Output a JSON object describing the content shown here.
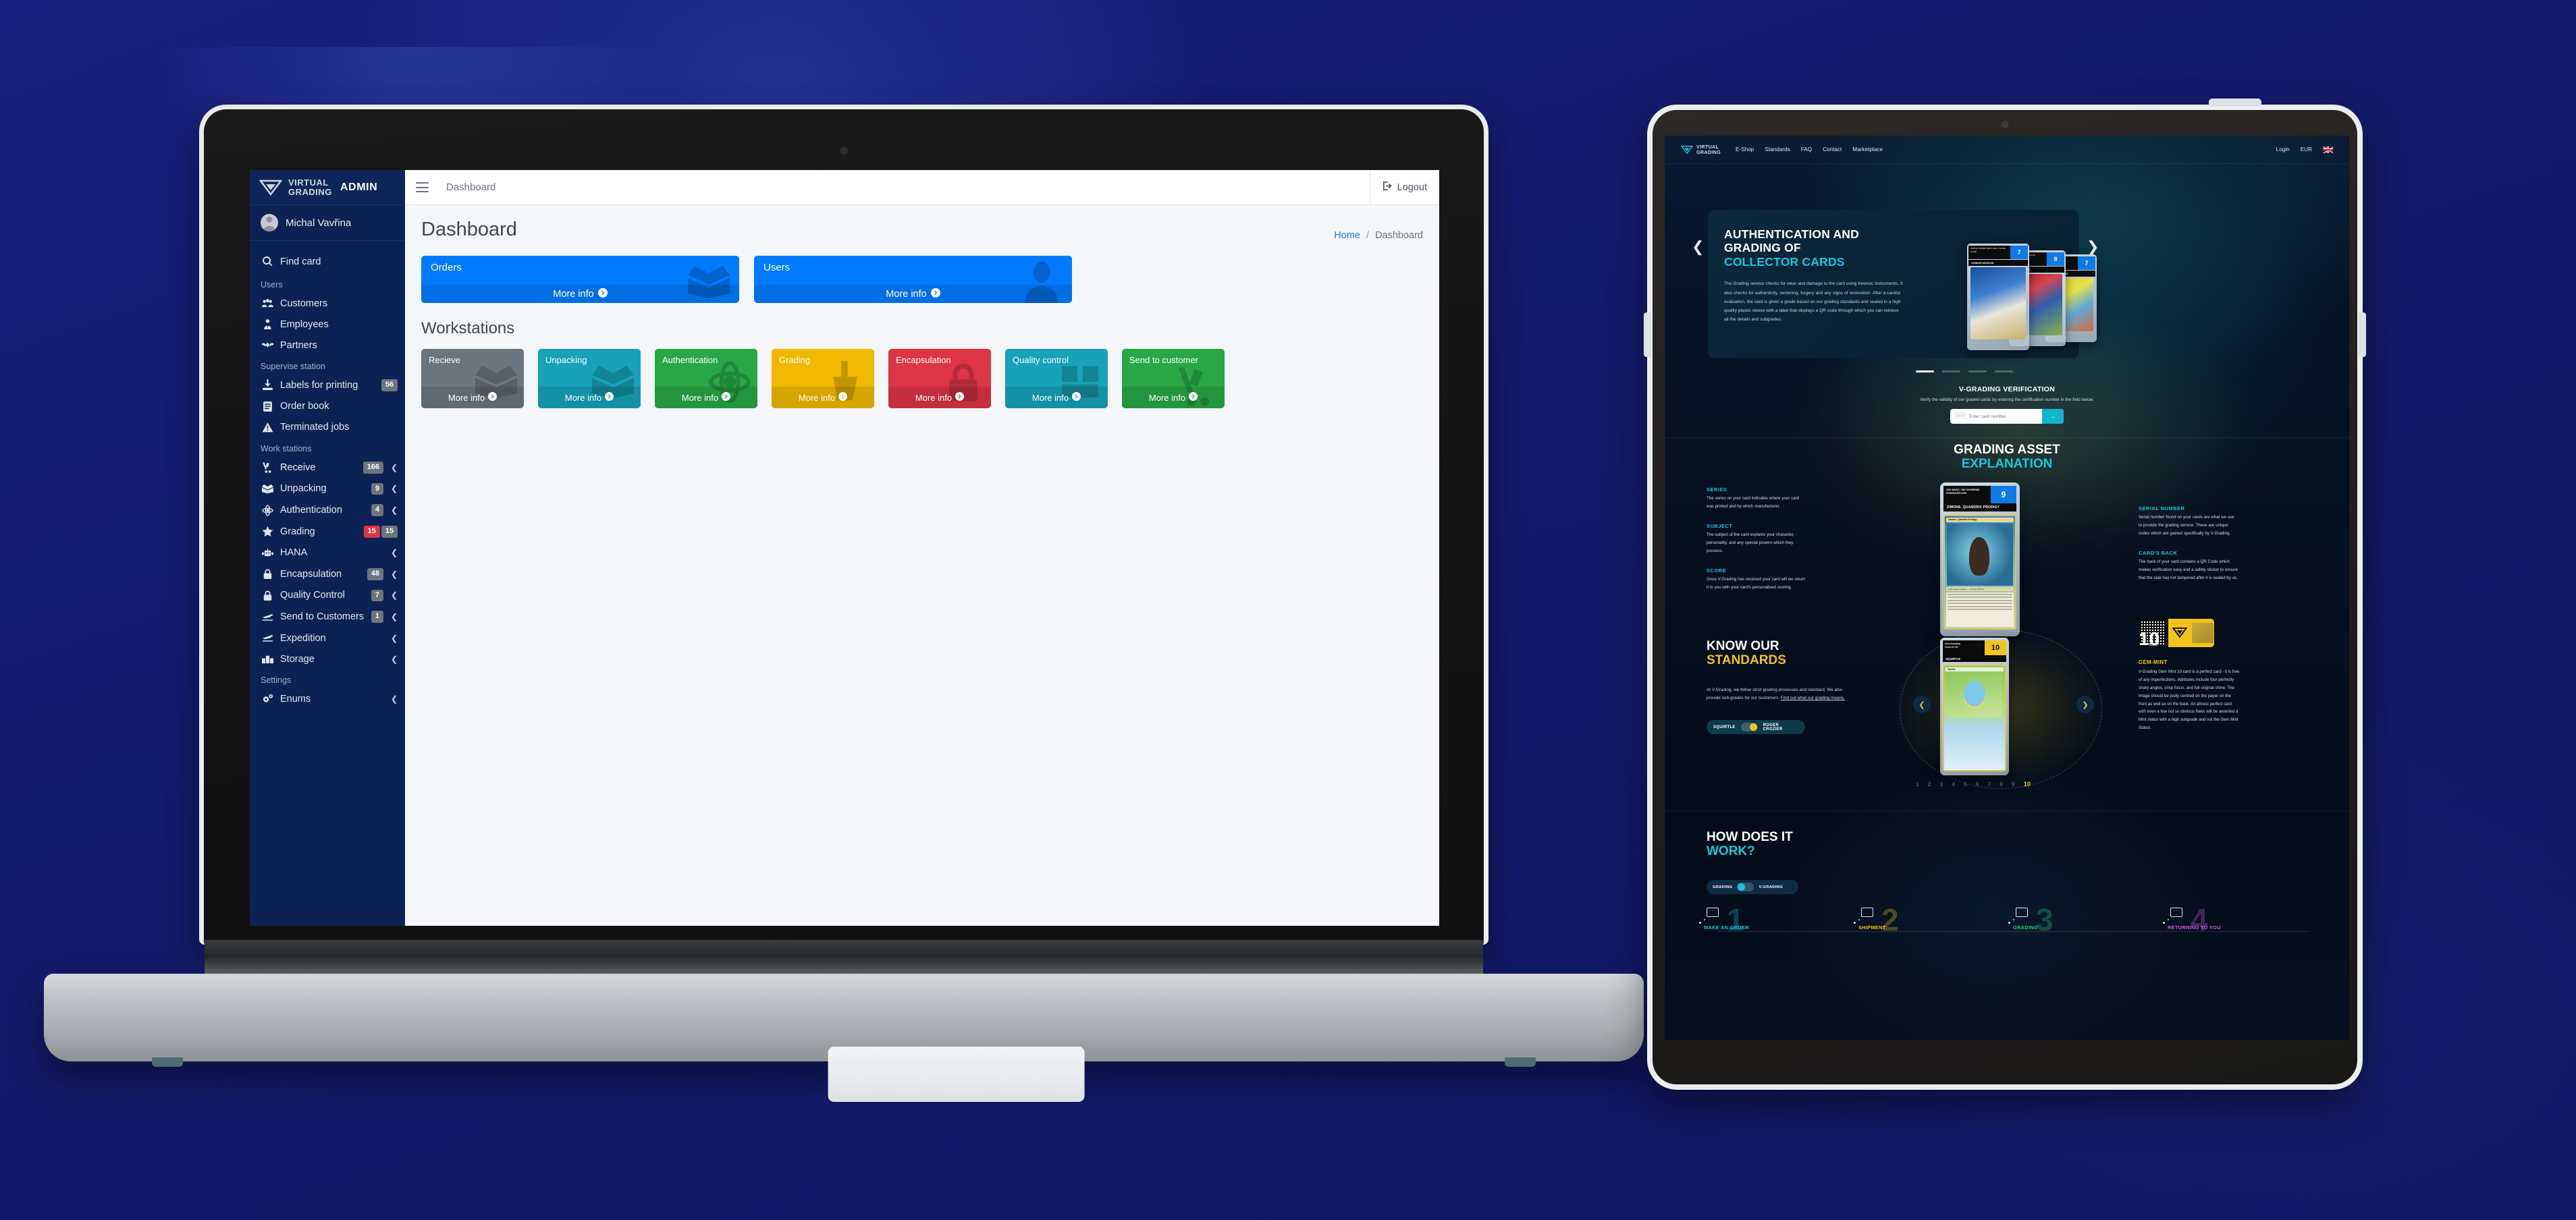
{
  "background": {
    "color": "#151c6e"
  },
  "laptop": {
    "admin_app": {
      "sidebar": {
        "brand": {
          "logo_line1": "VIRTUAL",
          "logo_line2": "GRADING",
          "suffix": "ADMIN"
        },
        "user": {
          "name": "Michal Vavřina",
          "avatar_icon": "user-avatar-icon"
        },
        "quick": {
          "label": "Find card",
          "icon": "search-icon"
        },
        "groups": [
          {
            "heading": "Users",
            "items": [
              {
                "label": "Customers",
                "icon": "users-group-icon",
                "badge": null,
                "chevron": false
              },
              {
                "label": "Employees",
                "icon": "user-tie-icon",
                "badge": null,
                "chevron": false
              },
              {
                "label": "Partners",
                "icon": "handshake-icon",
                "badge": null,
                "chevron": false
              }
            ]
          },
          {
            "heading": "Supervise station",
            "items": [
              {
                "label": "Labels for printing",
                "icon": "label-print-icon",
                "badge": "56",
                "chevron": false
              },
              {
                "label": "Order book",
                "icon": "book-icon",
                "badge": null,
                "chevron": false
              },
              {
                "label": "Terminated jobs",
                "icon": "warning-triangle-icon",
                "badge": null,
                "chevron": false
              }
            ]
          },
          {
            "heading": "Work stations",
            "items": [
              {
                "label": "Receive",
                "icon": "hand-truck-icon",
                "badge": "166",
                "chevron": true
              },
              {
                "label": "Unpacking",
                "icon": "open-box-icon",
                "badge": "9",
                "chevron": true
              },
              {
                "label": "Authentication",
                "icon": "atom-icon",
                "badge": "4",
                "chevron": true
              },
              {
                "label": "Grading",
                "icon": "star-icon",
                "badge": "15",
                "badge_alt": "15",
                "badge_color": "#dc3545",
                "chevron": false
              },
              {
                "label": "HANA",
                "icon": "robot-icon",
                "badge": null,
                "chevron": true
              },
              {
                "label": "Encapsulation",
                "icon": "lock-icon",
                "badge": "48",
                "chevron": true
              },
              {
                "label": "Quality Control",
                "icon": "lock-check-icon",
                "badge": "7",
                "chevron": true
              },
              {
                "label": "Send to Customers",
                "icon": "plane-depart-icon",
                "badge": "1",
                "chevron": true
              },
              {
                "label": "Expedition",
                "icon": "plane-depart-icon",
                "badge": null,
                "chevron": true
              },
              {
                "label": "Storage",
                "icon": "boxes-icon",
                "badge": null,
                "chevron": true
              }
            ]
          },
          {
            "heading": "Settings",
            "items": [
              {
                "label": "Enums",
                "icon": "gears-icon",
                "badge": null,
                "chevron": true
              }
            ]
          }
        ]
      },
      "topbar": {
        "burger_icon": "hamburger-menu-icon",
        "title": "Dashboard",
        "logout_label": "Logout",
        "logout_icon": "logout-icon"
      },
      "page": {
        "title": "Dashboard",
        "breadcrumb": {
          "home": "Home",
          "separator": "/",
          "current": "Dashboard"
        },
        "stat_cards": [
          {
            "label": "Orders",
            "cta": "More info",
            "color": "#007bff",
            "art_icon": "open-box-icon"
          },
          {
            "label": "Users",
            "cta": "More info",
            "color": "#007bff",
            "art_icon": "user-icon"
          }
        ],
        "section_title": "Workstations",
        "workstation_cards": [
          {
            "label": "Recieve",
            "cta": "More info",
            "color": "#6c757d",
            "art_icon": "open-box-icon"
          },
          {
            "label": "Unpacking",
            "cta": "More info",
            "color": "#17a2b8",
            "art_icon": "open-box-icon"
          },
          {
            "label": "Authentication",
            "cta": "More info",
            "color": "#28a745",
            "art_icon": "atom-icon"
          },
          {
            "label": "Grading",
            "cta": "More info",
            "color": "#f0b800",
            "art_icon": "hand-point-icon"
          },
          {
            "label": "Encapsulation",
            "cta": "More info",
            "color": "#dc3545",
            "art_icon": "lock-icon"
          },
          {
            "label": "Quality control",
            "cta": "More info",
            "color": "#17a2b8",
            "art_icon": "quality-icon"
          },
          {
            "label": "Send to customer",
            "cta": "More info",
            "color": "#28a745",
            "art_icon": "hand-truck-icon"
          }
        ]
      }
    }
  },
  "tablet": {
    "site": {
      "nav": {
        "logo_line1": "VIRTUAL",
        "logo_line2": "GRADING",
        "links": [
          "E-Shop",
          "Standards",
          "FAQ",
          "Contact",
          "Marketplace"
        ],
        "login_label": "Login",
        "currency": "EUR",
        "flag_icon": "uk-flag-icon"
      },
      "hero": {
        "title_line1": "AUTHENTICATION AND",
        "title_line2": "GRADING OF",
        "title_line3": "COLLECTOR CARDS",
        "body": "The Grading service checks for wear and damage to the card using forensic instruments. It also checks for authenticity, centering, forgery and any signs of restoration. After a careful evaluation, the card is given a grade based on our grading standards and sealed in a high quality plastic sleeve with a label that displays a QR code through which you can retrieve all the details and subgrades.",
        "prev_icon": "chevron-left-icon",
        "next_icon": "chevron-right-icon",
        "dots": 4,
        "active_dot": 1,
        "cards": [
          {
            "series": "2015-16 UPPER DECK #201 YOUNG GUNS",
            "name": "CONNOR MCDAVID",
            "grade": "7",
            "grade_label": "ELITE"
          },
          {
            "series": "2004-05 MEGACRACKS",
            "name": "LIONEL MESSI",
            "grade": "8",
            "grade_label": "N-MINT"
          },
          {
            "series": "2020 POKEMON",
            "name": "CHARIZARD GX",
            "grade": "7",
            "grade_label": "ELITE"
          }
        ]
      },
      "verification": {
        "title": "V-GRADING VERIFICATION",
        "subtitle": "Verify the validity of our graded cards by entering the certification number in the field below.",
        "input_placeholder": "Enter card number",
        "input_value": "",
        "input_icon": "card-id-icon",
        "submit_icon": "arrow-right-icon",
        "accent": "#12b5cf"
      },
      "grading_asset": {
        "title_line1": "GRADING ASSET",
        "title_line2": "EXPLANATION",
        "left_blocks": [
          {
            "heading": "SERIES",
            "body": "The series on your card indicates where your card was printed and by which manufacturer."
          },
          {
            "heading": "SUBJECT",
            "body": "The subject of the card explains your character, personality, and any special powers which they possess."
          },
          {
            "heading": "SCORE",
            "body": "Once V-Grading has received your card will we return it to you with your card's personalised scoring."
          }
        ],
        "right_blocks": [
          {
            "heading": "SERIAL NUMBER",
            "body": "Serial number found on your cards are what we use to provide the grading service. These are unique codes which are gained specifically by V-Grading."
          },
          {
            "heading": "CARD'S BACK",
            "body": "The back of your card contains a QR Code which makes verification easy and a safety sticker to ensure that the slab has not tampered after it is sealed by us."
          }
        ],
        "slab": {
          "series_line1": "2021 MAGIC: THE GATHERING",
          "series_line2": "STRIXHAVEN #250",
          "grade": "9",
          "grade_label": "MINT",
          "card_name": "ZIMONE, QUANDRIX PRODIGY",
          "card_title": "Zimone, Quandrix Prodigy",
          "card_type": "Legendary Creature — Human Wizard",
          "card_pt": "1/2"
        },
        "qr_number": "00000",
        "qr_icon": "qr-code-icon",
        "sticker_icon": "security-sticker-icon"
      },
      "standards": {
        "title_line1": "KNOW OUR",
        "title_line2": "STANDARDS",
        "body": "At V-Grading, we follow strict grading processes and standard. We also provide sub-grades for our customers.",
        "link": "Find out what our grading means.",
        "toggle_left": "SQUIRTLE",
        "toggle_right": "ROGER CROZIER",
        "slab": {
          "series_line1": "2019 POKEMON",
          "series_line2": "TEAM UP #22",
          "grade": "10",
          "grade_label": "G-MINT",
          "card_name": "SQUIRTLE",
          "card_title": "Squirtle"
        },
        "scale": [
          "1",
          "2",
          "3",
          "4",
          "5",
          "6",
          "7",
          "8",
          "9",
          "10"
        ],
        "scale_active": "10",
        "grade_big": "10",
        "grade_heading": "GEM-MINT",
        "grade_body": "V-Grading Gem Mint 10 card is a perfect card - it is free of any imperfections. Attributes include four perfectly sharp angles, crisp focus, and full original shine. The image should be justly centred on the paper on the front as well as on the back. An almost perfect card with even a few not so obvious flaws will be awarded a Mint status with a high subgrade and not the Gem Mint Status.",
        "prev_icon": "chevron-left-icon",
        "next_icon": "chevron-right-icon"
      },
      "how_it_works": {
        "title_line1": "HOW DOES IT",
        "title_line2": "WORK?",
        "toggle_left": "GRADING",
        "toggle_right": "V-GRADING",
        "steps": [
          {
            "number": "1",
            "label": "MAKE AN ORDER",
            "color": "#19c6e0",
            "icon": "card-cart-icon"
          },
          {
            "number": "2",
            "label": "SHIPMENT",
            "color": "#f2c41a",
            "icon": "card-box-icon"
          },
          {
            "number": "3",
            "label": "GRADING",
            "color": "#1fd67a",
            "icon": "card-magnify-icon"
          },
          {
            "number": "4",
            "label": "RETURNING TO YOU",
            "color": "#d957e8",
            "icon": "card-plane-icon"
          }
        ]
      }
    }
  }
}
